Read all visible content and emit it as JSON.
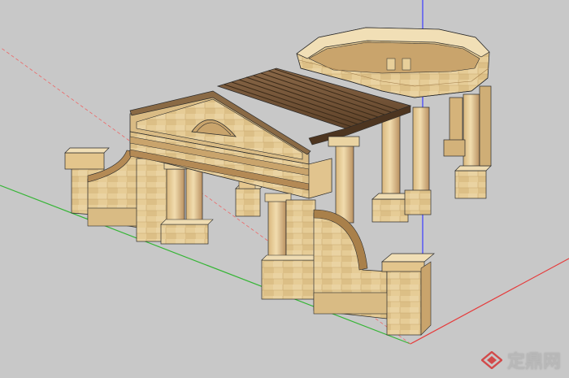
{
  "watermark": {
    "text": "定鼎网",
    "logo": "dingding-diamond-logo"
  },
  "colors": {
    "background": "#c8c8c8",
    "stone": "#e8cf9a",
    "stone_dark": "#c9a46c",
    "stone_shadow": "#b48a55",
    "wood": "#7a5a3a",
    "axis_green": "#35b535",
    "axis_blue": "#3b3bff",
    "axis_red": "#e63a3a",
    "edge": "#2a2a2a"
  },
  "scene": {
    "model": "stone-pergola-colonnade",
    "axes": [
      "green-axis",
      "blue-axis",
      "red-axis"
    ]
  }
}
